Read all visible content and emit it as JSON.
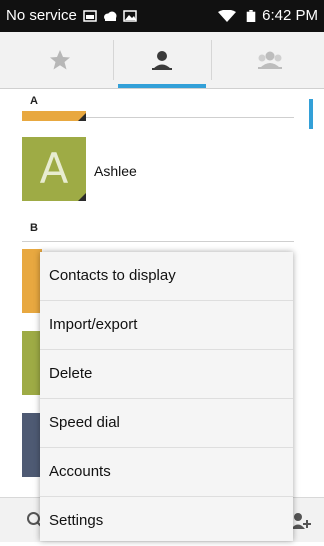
{
  "status_bar": {
    "carrier_text": "No service",
    "time": "6:42 PM",
    "icons": [
      "sim-card-icon",
      "cloud-icon",
      "image-icon",
      "wifi-icon",
      "battery-icon"
    ]
  },
  "tabs": [
    {
      "icon": "star-icon",
      "name": "favorites",
      "selected": false
    },
    {
      "icon": "person-icon",
      "name": "contacts",
      "selected": true
    },
    {
      "icon": "group-icon",
      "name": "groups",
      "selected": false
    }
  ],
  "contacts": {
    "sections": [
      {
        "letter": "A"
      },
      {
        "letter": "B"
      }
    ],
    "items": [
      {
        "initial": "A",
        "name": "Ashlee",
        "color": "#9eab45"
      }
    ],
    "partial_tile_colors": [
      "#e8a840",
      "#e8a840",
      "#9eab45",
      "#4e5a73"
    ]
  },
  "menu": {
    "items": [
      {
        "label": "Contacts to display"
      },
      {
        "label": "Import/export"
      },
      {
        "label": "Delete"
      },
      {
        "label": "Speed dial"
      },
      {
        "label": "Accounts"
      },
      {
        "label": "Settings"
      }
    ]
  },
  "bottom_bar": {
    "icons": [
      "search-icon",
      "add-contact-icon"
    ]
  },
  "colors": {
    "accent": "#33a0d8",
    "status_bar": "#111111",
    "tab_bar": "#f2f2f2",
    "menu_bg": "#f5f5f5"
  }
}
